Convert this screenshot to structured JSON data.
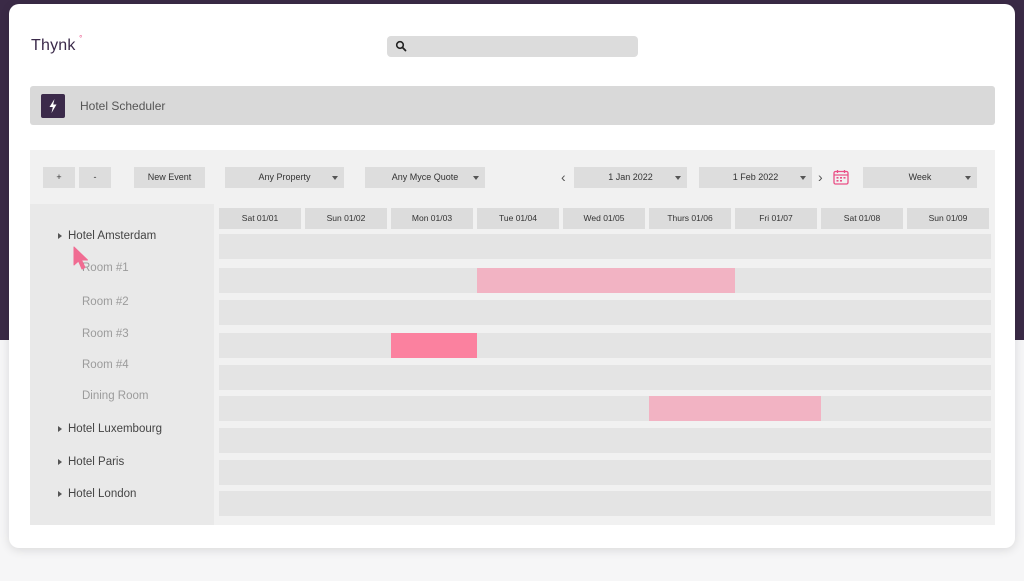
{
  "app": {
    "logo_text": "Thynk",
    "logo_mark": "°",
    "brand_color": "#3b2a4a",
    "accent_color": "#ea4f86"
  },
  "search": {
    "placeholder": "",
    "value": ""
  },
  "header": {
    "title": "Hotel Scheduler",
    "icon": "bolt-icon"
  },
  "toolbar": {
    "zoom_in_label": "+",
    "zoom_out_label": "-",
    "new_event_label": "New Event",
    "property_filter": "Any Property",
    "quote_filter": "Any Myce Quote",
    "prev_label": "‹",
    "next_label": "›",
    "start_date": "1 Jan 2022",
    "end_date": "1 Feb 2022",
    "view_mode": "Week",
    "calendar_icon": "calendar-icon"
  },
  "days": [
    "Sat 01/01",
    "Sun 01/02",
    "Mon 01/03",
    "Tue 01/04",
    "Wed 01/05",
    "Thurs 01/06",
    "Fri 01/07",
    "Sat 01/08",
    "Sun 01/09"
  ],
  "tree": [
    {
      "label": "Hotel Amsterdam",
      "type": "hotel",
      "expanded": true
    },
    {
      "label": "Room #1",
      "type": "room"
    },
    {
      "label": "Room #2",
      "type": "room"
    },
    {
      "label": "Room #3",
      "type": "room"
    },
    {
      "label": "Room #4",
      "type": "room"
    },
    {
      "label": "Dining Room",
      "type": "room"
    },
    {
      "label": "Hotel Luxembourg",
      "type": "hotel",
      "expanded": false
    },
    {
      "label": "Hotel Paris",
      "type": "hotel",
      "expanded": false
    },
    {
      "label": "Hotel London",
      "type": "hotel",
      "expanded": false
    }
  ],
  "events": [
    {
      "row": "Room #1",
      "start_day": "Tue 01/04",
      "end_day": "Fri 01/07",
      "color": "#f2b3c3"
    },
    {
      "row": "Room #3",
      "start_day": "Mon 01/03",
      "end_day": "Tue 01/04",
      "color": "#fb819f"
    },
    {
      "row": "Dining Room",
      "start_day": "Thurs 01/06",
      "end_day": "Sat 01/08",
      "color": "#f2b3c3"
    }
  ]
}
